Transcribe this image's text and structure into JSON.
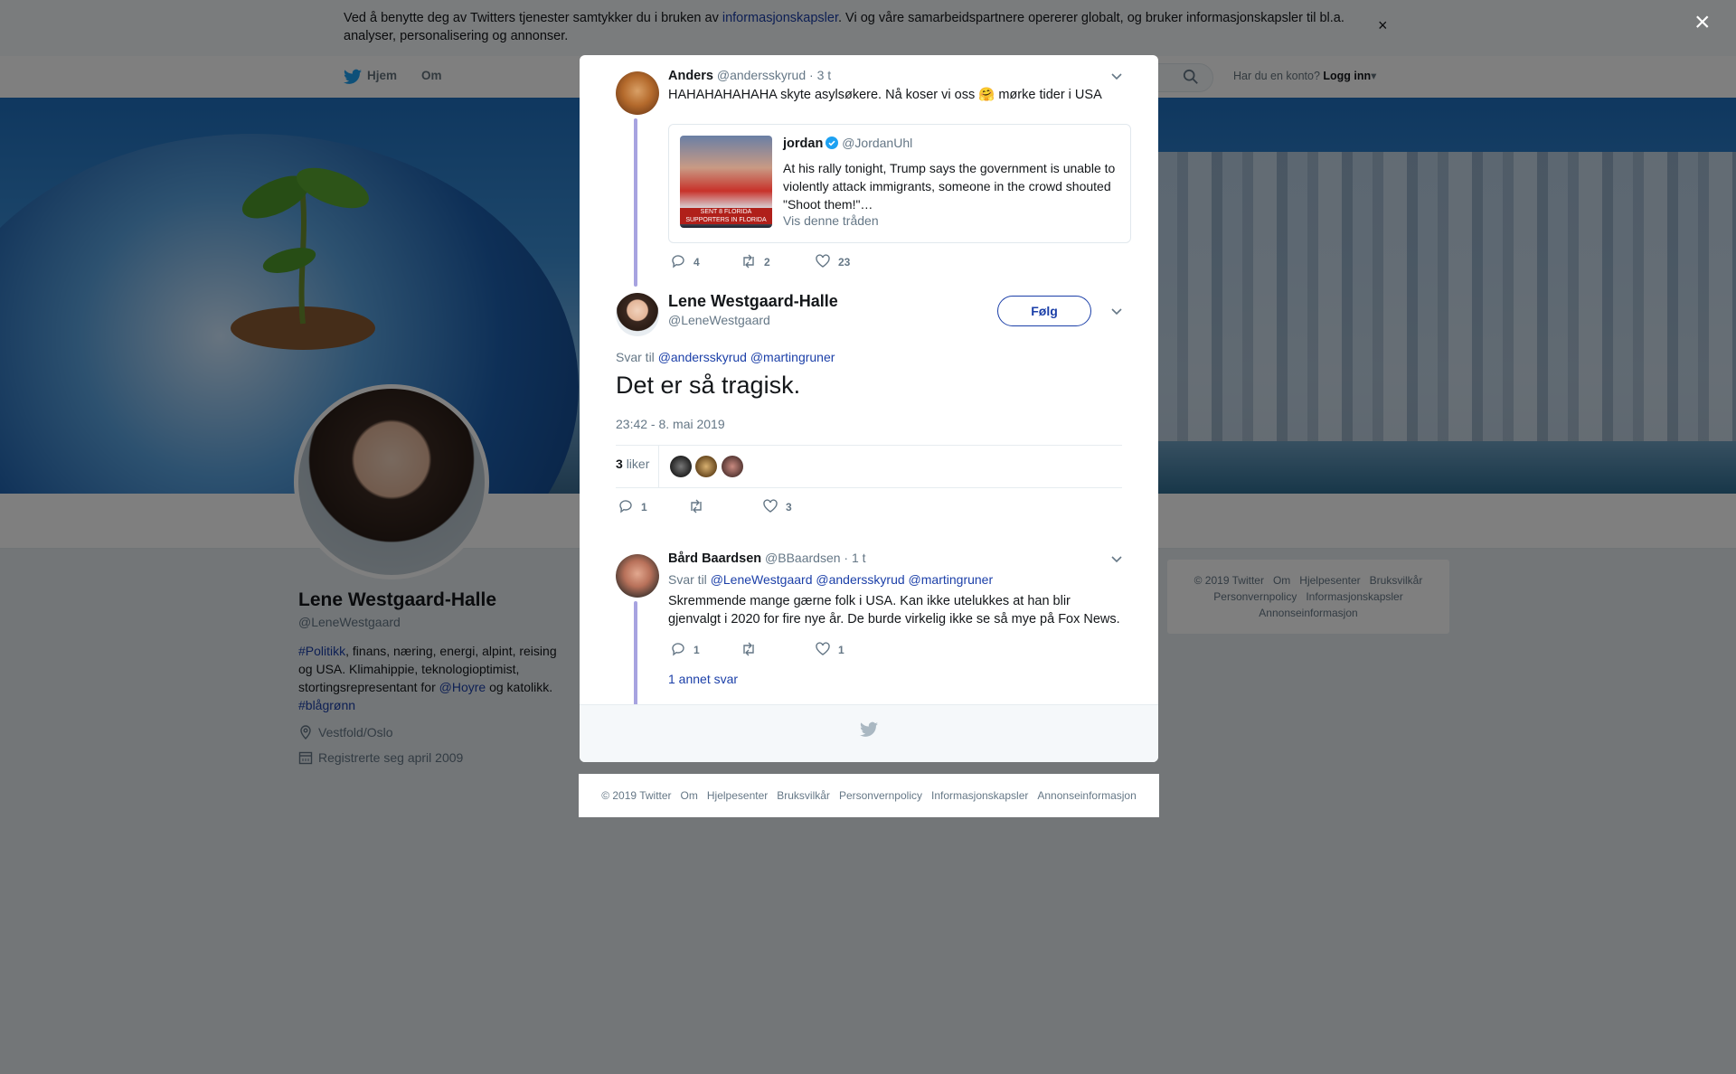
{
  "colors": {
    "link": "#1b3fa8",
    "twitter_blue": "#1da1f2",
    "thread_line": "#a7a3e0",
    "overlay": "rgba(0,0,0,0.5)"
  },
  "cookie_banner": {
    "text_before": "Ved å benytte deg av Twitters tjenester samtykker du i bruken av ",
    "link": "informasjonskapsler",
    "text_after": ". Vi og våre samarbeidspartnere opererer globalt, og bruker informasjonskapsler til bl.a. analyser, personalisering og annonser.",
    "close": "×"
  },
  "nav": {
    "home": "Hjem",
    "about": "Om",
    "login_prompt": "Har du en konto?",
    "login": "Logg inn",
    "login_caret": "▾"
  },
  "profile": {
    "name": "Lene Westgaard-Halle",
    "handle": "@LeneWestgaard",
    "bio_tag1": "#Politikk",
    "bio_text1": ", finans, næring, energi, alpint, reising og USA. Klimahippie, teknologioptimist, stortingsrepresentant for ",
    "bio_mention": "@Hoyre",
    "bio_text2": " og katolikk. ",
    "bio_tag2": "#blågrønn",
    "location": "Vestfold/Oslo",
    "joined": "Registrerte seg april 2009"
  },
  "side_footer": [
    "© 2019 Twitter",
    "Om",
    "Hjelpesenter",
    "Bruksvilkår",
    "Personvernpolicy",
    "Informasjonskapsler",
    "Annonseinformasjon"
  ],
  "overlay_close": "×",
  "modal": {
    "parent_tweet": {
      "name": "Anders",
      "handle": "@andersskyrud",
      "time": "· 3 t",
      "text": "HAHAHAHAHAHA skyte asylsøkere. Nå koser vi oss 🤗 mørke tider i USA",
      "quote": {
        "name": "jordan",
        "handle": "@JordanUhl",
        "text": "At his rally tonight, Trump says the government is unable to violently attack immigrants, someone in the crowd shouted \"Shoot them!\"…",
        "thread_link": "Vis denne tråden",
        "thumb_caption": "SENT 8 FLORIDA SUPPORTERS IN FLORIDA"
      },
      "replies": "4",
      "retweets": "2",
      "likes": "23"
    },
    "main_tweet": {
      "name": "Lene Westgaard-Halle",
      "handle": "@LeneWestgaard",
      "follow": "Følg",
      "reply_to_label": "Svar til",
      "reply_to_1": "@andersskyrud",
      "reply_to_2": "@martingruner",
      "text": "Det er så tragisk.",
      "timestamp": "23:42 - 8. mai 2019",
      "likes_count": "3",
      "likes_label": "liker",
      "replies": "1",
      "retweets": "",
      "likes": "3"
    },
    "reply_tweet": {
      "name": "Bård Baardsen",
      "handle": "@BBaardsen",
      "time": "· 1 t",
      "reply_to_label": "Svar til",
      "reply_to_1": "@LeneWestgaard",
      "reply_to_2": "@andersskyrud",
      "reply_to_3": "@martingruner",
      "text": "Skremmende mange gærne folk i USA. Kan ikke utelukkes at han blir gjenvalgt i 2020 for fire nye år. De burde virkelig ikke se så mye på Fox News.",
      "replies": "1",
      "retweets": "",
      "likes": "1",
      "more_replies": "1 annet svar"
    }
  },
  "modal_footer": [
    "© 2019 Twitter",
    "Om",
    "Hjelpesenter",
    "Bruksvilkår",
    "Personvernpolicy",
    "Informasjonskapsler",
    "Annonseinformasjon"
  ]
}
